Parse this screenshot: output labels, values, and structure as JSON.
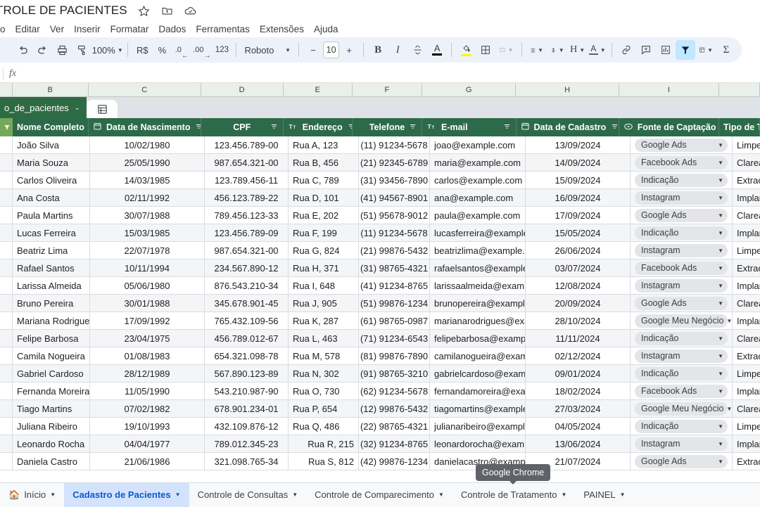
{
  "document": {
    "title": "TROLE DE PACIENTES",
    "title_icons": [
      "star-icon",
      "move-to-folder-icon",
      "cloud-saved-icon"
    ]
  },
  "menubar": {
    "items": [
      "o",
      "Editar",
      "Ver",
      "Inserir",
      "Formatar",
      "Dados",
      "Ferramentas",
      "Extensões",
      "Ajuda"
    ]
  },
  "toolbar": {
    "undo": "undo-icon",
    "redo": "redo-icon",
    "print": "print-icon",
    "paint_format": "paint-format-icon",
    "zoom": "100%",
    "currency": "R$",
    "percent": "%",
    "decrease_decimal": ".0",
    "increase_decimal": ".00",
    "more_formats": "123",
    "font_name": "Roboto",
    "font_decrease": "−",
    "font_size": "10",
    "font_increase": "+",
    "bold": "B",
    "italic": "I",
    "strikethrough": "S",
    "text_color": "A",
    "fill_color": "fill-color-icon",
    "borders": "borders-icon",
    "merge_cells": "merge-cells-icon",
    "halign": "horizontal-align-icon",
    "valign": "vertical-align-icon",
    "text_wrap": "H",
    "text_rotation": "A",
    "insert_link": "link-icon",
    "insert_comment": "comment-icon",
    "insert_chart": "chart-icon",
    "create_filter": "filter-icon",
    "filter_views": "filter-views-icon",
    "functions": "Σ"
  },
  "formula_bar": {
    "fx": "fx",
    "value": ""
  },
  "grid": {
    "column_letters": [
      "B",
      "C",
      "D",
      "E",
      "F",
      "G",
      "H",
      "I"
    ],
    "named_range": {
      "label": "o_de_pacientes",
      "tab_icon": "table-icon"
    },
    "headers": [
      {
        "label": "Nome Completo",
        "icon": "",
        "align": "left"
      },
      {
        "label": "Data de Nascimento",
        "icon": "calendar-icon",
        "align": "center"
      },
      {
        "label": "CPF",
        "icon": "",
        "align": "center"
      },
      {
        "label": "Endereço",
        "icon": "text-type-icon",
        "align": "left"
      },
      {
        "label": "Telefone",
        "icon": "",
        "align": "center"
      },
      {
        "label": "E-mail",
        "icon": "text-type-icon",
        "align": "left"
      },
      {
        "label": "Data de Cadastro",
        "icon": "calendar-icon",
        "align": "center"
      },
      {
        "label": "Fonte de Captação",
        "icon": "dropdown-type-icon",
        "align": "left"
      },
      {
        "label": "Tipo de T",
        "icon": "",
        "align": "left"
      }
    ],
    "rows": [
      {
        "nome": "João Silva",
        "nascimento": "10/02/1980",
        "cpf": "123.456.789-00",
        "endereco": "Rua A, 123",
        "endereco_align": "left",
        "telefone": "(11) 91234-5678",
        "email": "joao@example.com",
        "cadastro": "13/09/2024",
        "fonte": "Google Ads",
        "tipo": "Limpeza"
      },
      {
        "nome": "Maria Souza",
        "nascimento": "25/05/1990",
        "cpf": "987.654.321-00",
        "endereco": "Rua B, 456",
        "endereco_align": "left",
        "telefone": "(21) 92345-6789",
        "email": "maria@example.com",
        "cadastro": "14/09/2024",
        "fonte": "Facebook Ads",
        "tipo": "Clareame"
      },
      {
        "nome": "Carlos Oliveira",
        "nascimento": "14/03/1985",
        "cpf": "123.789.456-11",
        "endereco": "Rua C, 789",
        "endereco_align": "left",
        "telefone": "(31) 93456-7890",
        "email": "carlos@example.com",
        "cadastro": "15/09/2024",
        "fonte": "Indicação",
        "tipo": "Extração"
      },
      {
        "nome": "Ana Costa",
        "nascimento": "02/11/1992",
        "cpf": "456.123.789-22",
        "endereco": "Rua D, 101",
        "endereco_align": "left",
        "telefone": "(41) 94567-8901",
        "email": "ana@example.com",
        "cadastro": "16/09/2024",
        "fonte": "Instagram",
        "tipo": "Implante"
      },
      {
        "nome": "Paula Martins",
        "nascimento": "30/07/1988",
        "cpf": "789.456.123-33",
        "endereco": "Rua E, 202",
        "endereco_align": "left",
        "telefone": "(51) 95678-9012",
        "email": "paula@example.com",
        "cadastro": "17/09/2024",
        "fonte": "Google Ads",
        "tipo": "Clareame"
      },
      {
        "nome": "Lucas Ferreira",
        "nascimento": "15/03/1985",
        "cpf": "123.456.789-09",
        "endereco": "Rua F, 199",
        "endereco_align": "left",
        "telefone": "(11) 91234-5678",
        "email": "lucasferreira@example.",
        "cadastro": "15/05/2024",
        "fonte": "Indicação",
        "tipo": "Implantes"
      },
      {
        "nome": "Beatriz Lima",
        "nascimento": "22/07/1978",
        "cpf": "987.654.321-00",
        "endereco": "Rua G, 824",
        "endereco_align": "left",
        "telefone": "(21) 99876-5432",
        "email": "beatrizlima@example.c",
        "cadastro": "26/06/2024",
        "fonte": "Instagram",
        "tipo": "Limpeza"
      },
      {
        "nome": "Rafael Santos",
        "nascimento": "10/11/1994",
        "cpf": "234.567.890-12",
        "endereco": "Rua H, 371",
        "endereco_align": "left",
        "telefone": "(31) 98765-4321",
        "email": "rafaelsantos@example.",
        "cadastro": "03/07/2024",
        "fonte": "Facebook Ads",
        "tipo": "Extração"
      },
      {
        "nome": "Larissa Almeida",
        "nascimento": "05/06/1980",
        "cpf": "876.543.210-34",
        "endereco": "Rua I, 648",
        "endereco_align": "left",
        "telefone": "(41) 91234-8765",
        "email": "larissaalmeida@examp",
        "cadastro": "12/08/2024",
        "fonte": "Instagram",
        "tipo": "Implante"
      },
      {
        "nome": "Bruno Pereira",
        "nascimento": "30/01/1988",
        "cpf": "345.678.901-45",
        "endereco": "Rua J, 905",
        "endereco_align": "left",
        "telefone": "(51) 99876-1234",
        "email": "brunopereira@example",
        "cadastro": "20/09/2024",
        "fonte": "Google Ads",
        "tipo": "Clareame"
      },
      {
        "nome": "Mariana Rodrigues",
        "nascimento": "17/09/1992",
        "cpf": "765.432.109-56",
        "endereco": "Rua K, 287",
        "endereco_align": "left",
        "telefone": "(61) 98765-0987",
        "email": "marianarodrigues@exa",
        "cadastro": "28/10/2024",
        "fonte": "Google Meu Negócio",
        "tipo": "Implantes"
      },
      {
        "nome": "Felipe Barbosa",
        "nascimento": "23/04/1975",
        "cpf": "456.789.012-67",
        "endereco": "Rua L, 463",
        "endereco_align": "left",
        "telefone": "(71) 91234-6543",
        "email": "felipebarbosa@exampl",
        "cadastro": "11/11/2024",
        "fonte": "Indicação",
        "tipo": "Clareame"
      },
      {
        "nome": "Camila Nogueira",
        "nascimento": "01/08/1983",
        "cpf": "654.321.098-78",
        "endereco": "Rua M, 578",
        "endereco_align": "left",
        "telefone": "(81) 99876-7890",
        "email": "camilanogueira@examp",
        "cadastro": "02/12/2024",
        "fonte": "Instagram",
        "tipo": "Extração"
      },
      {
        "nome": "Gabriel Cardoso",
        "nascimento": "28/12/1989",
        "cpf": "567.890.123-89",
        "endereco": "Rua N, 302",
        "endereco_align": "left",
        "telefone": "(91) 98765-3210",
        "email": "gabrielcardoso@examp",
        "cadastro": "09/01/2024",
        "fonte": "Indicação",
        "tipo": "Limpeza"
      },
      {
        "nome": "Fernanda Moreira",
        "nascimento": "11/05/1990",
        "cpf": "543.210.987-90",
        "endereco": "Rua O, 730",
        "endereco_align": "left",
        "telefone": "(62) 91234-5678",
        "email": "fernandamoreira@exan",
        "cadastro": "18/02/2024",
        "fonte": "Facebook Ads",
        "tipo": "Implante"
      },
      {
        "nome": "Tiago Martins",
        "nascimento": "07/02/1982",
        "cpf": "678.901.234-01",
        "endereco": "Rua P, 654",
        "endereco_align": "left",
        "telefone": "(12) 99876-5432",
        "email": "tiagomartins@example",
        "cadastro": "27/03/2024",
        "fonte": "Google Meu Negócio",
        "tipo": "Clareame"
      },
      {
        "nome": "Juliana Ribeiro",
        "nascimento": "19/10/1993",
        "cpf": "432.109.876-12",
        "endereco": "Rua Q, 486",
        "endereco_align": "left",
        "telefone": "(22) 98765-4321",
        "email": "julianaribeiro@example",
        "cadastro": "04/05/2024",
        "fonte": "Indicação",
        "tipo": "Limpeza"
      },
      {
        "nome": "Leonardo Rocha",
        "nascimento": "04/04/1977",
        "cpf": "789.012.345-23",
        "endereco": "Rua R, 215",
        "endereco_align": "right",
        "telefone": "(32) 91234-8765",
        "email": "leonardorocha@examp",
        "cadastro": "13/06/2024",
        "fonte": "Instagram",
        "tipo": "Implantes"
      },
      {
        "nome": "Daniela Castro",
        "nascimento": "21/06/1986",
        "cpf": "321.098.765-34",
        "endereco": "Rua S, 812",
        "endereco_align": "right",
        "telefone": "(42) 99876-1234",
        "email": "danielacastro@example",
        "cadastro": "21/07/2024",
        "fonte": "Google Ads",
        "tipo": "Extração"
      }
    ]
  },
  "sheet_tabs": [
    {
      "label": "Início",
      "icon": "house-emoji",
      "active": false
    },
    {
      "label": "Cadastro de Pacientes",
      "icon": "",
      "active": true
    },
    {
      "label": "Controle de Consultas",
      "icon": "",
      "active": false
    },
    {
      "label": "Controle de Comparecimento",
      "icon": "",
      "active": false
    },
    {
      "label": "Controle de Tratamento",
      "icon": "",
      "active": false
    },
    {
      "label": "PAINEL",
      "icon": "",
      "active": false
    }
  ],
  "tooltip": {
    "text": "Google Chrome"
  },
  "colors": {
    "header_green": "#2d6a4a",
    "col_header_green": "#e8f0e9",
    "active_tab_blue": "#d3e3fd",
    "active_tab_text": "#0b57d0",
    "toolbar_bg": "#edf2fa"
  }
}
